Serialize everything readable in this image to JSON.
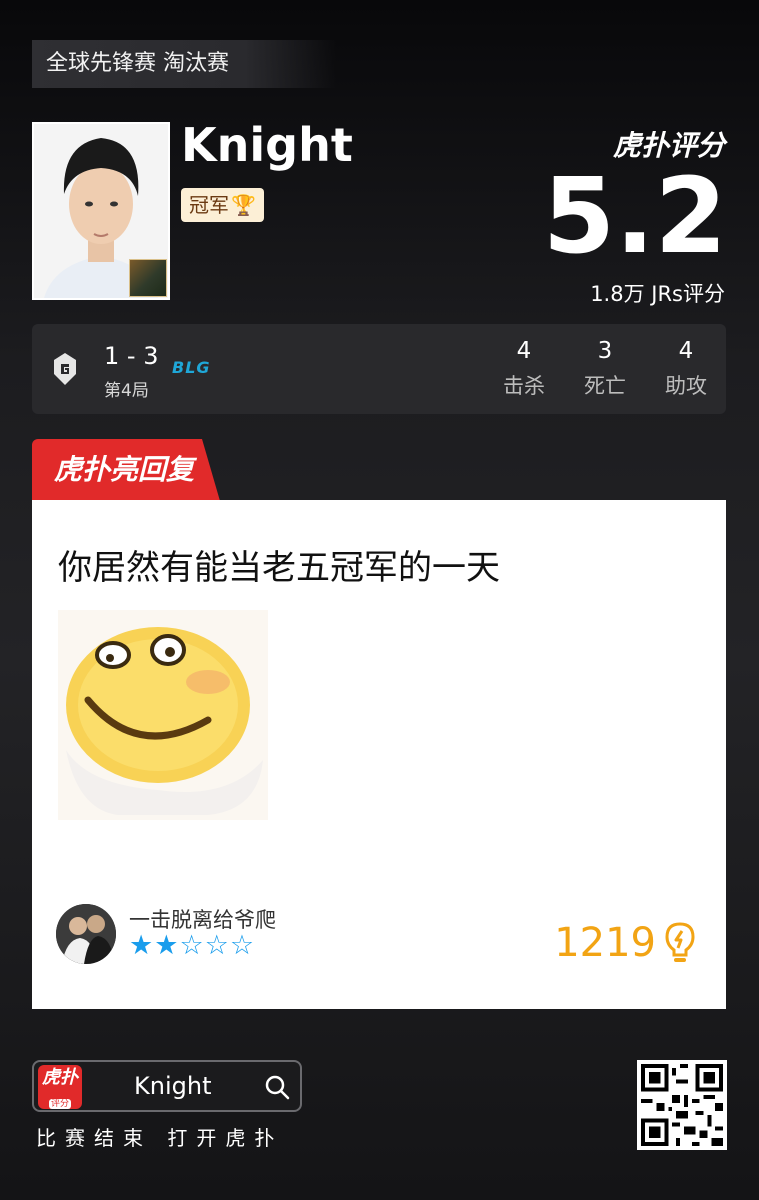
{
  "event": "全球先锋赛 淘汰赛",
  "player": {
    "name": "Knight",
    "badge": "冠军",
    "badge_icon": "trophy-icon"
  },
  "rating": {
    "brand": "虎扑评分",
    "score": "5.2",
    "count": "1.8万 JRs评分"
  },
  "match": {
    "team_a_logo": "g2-logo",
    "score": "1 - 3",
    "game": "第4局",
    "team_b_logo": "blg-logo",
    "team_b_text": "BLG",
    "stats": [
      {
        "value": "4",
        "label": "击杀"
      },
      {
        "value": "3",
        "label": "死亡"
      },
      {
        "value": "4",
        "label": "助攻"
      }
    ]
  },
  "reply": {
    "ribbon": "虎扑亮回复",
    "text": "你居然有能当老五冠军的一天",
    "user": "一击脱离给爷爬",
    "stars_filled": 2,
    "stars_total": 5,
    "likes": "1219",
    "likes_icon": "lightbulb-icon"
  },
  "footer": {
    "app_icon_text": "虎扑",
    "app_icon_sub": "评分",
    "search_text": "Knight",
    "caption": "比赛结束 打开虎扑",
    "qr": "qr-code"
  },
  "colors": {
    "accent_red": "#e12a2a",
    "star_blue": "#1a9dec",
    "likes_orange": "#f2a414"
  }
}
